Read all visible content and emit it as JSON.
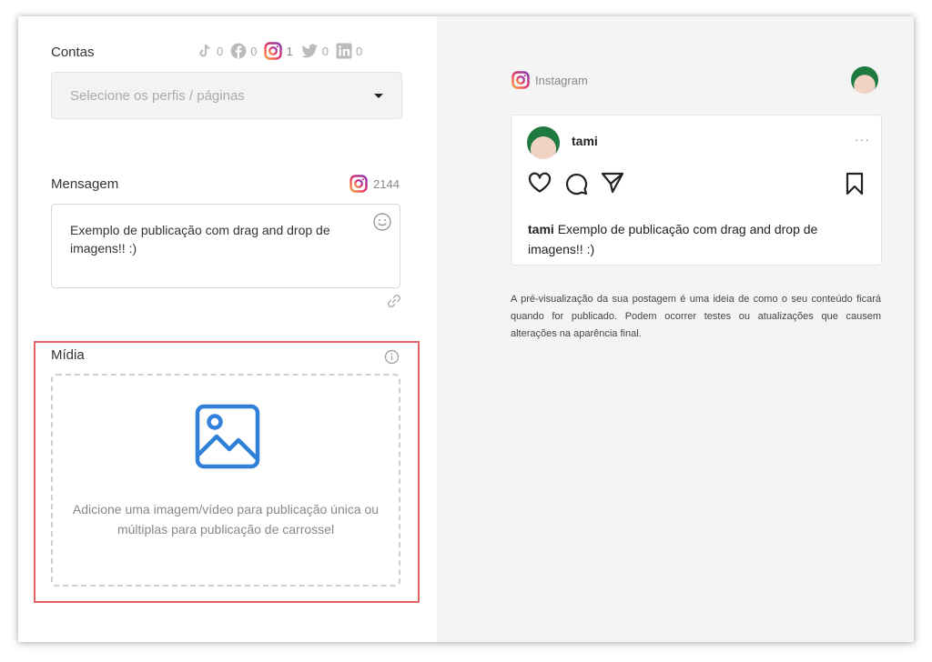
{
  "accounts": {
    "label": "Contas",
    "networks": [
      {
        "name": "tiktok",
        "icon": "tiktok-icon",
        "count": "0"
      },
      {
        "name": "facebook",
        "icon": "facebook-icon",
        "count": "0"
      },
      {
        "name": "instagram",
        "icon": "instagram-icon",
        "count": "1"
      },
      {
        "name": "twitter",
        "icon": "twitter-icon",
        "count": "0"
      },
      {
        "name": "linkedin",
        "icon": "linkedin-icon",
        "count": "0"
      }
    ],
    "select_placeholder": "Selecione os perfis / páginas"
  },
  "message": {
    "label": "Mensagem",
    "char_count": "2144",
    "text": "Exemplo de publicação com drag and drop de imagens!! :)"
  },
  "media": {
    "label": "Mídia",
    "dropzone_text": "Adicione uma imagem/vídeo para publicação única ou múltiplas para publicação de carrossel"
  },
  "preview": {
    "network_label": "Instagram",
    "username": "tami",
    "caption": "Exemplo de publicação com drag and drop de imagens!! :)",
    "more": "···",
    "disclaimer": "A pré-visualização da sua postagem é uma ideia de como o seu conteúdo ficará quando for publicado. Podem ocorrer testes ou atualizações que causem alterações na aparência final."
  },
  "colors": {
    "highlight": "#e06464",
    "accent_blue": "#2f80d8",
    "preview_bg": "#f4f4f4"
  }
}
